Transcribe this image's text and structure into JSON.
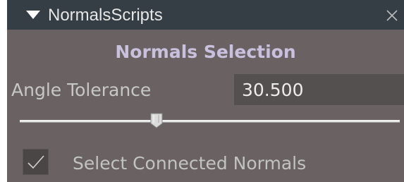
{
  "window": {
    "title": "NormalsScripts",
    "collapse_icon": "triangle-down-icon",
    "close_icon": "close-x-icon"
  },
  "section": {
    "heading": "Normals Selection"
  },
  "angle_tolerance": {
    "label": "Angle Tolerance",
    "value": "30.500",
    "slider_fraction": 0.36
  },
  "options": {
    "select_connected_label": "Select Connected Normals",
    "select_connected_checked": true
  },
  "colors": {
    "titlebar": "#353d45",
    "panel_background": "#6a6262",
    "heading_text": "#c8c0dd",
    "field_background": "#555050"
  }
}
